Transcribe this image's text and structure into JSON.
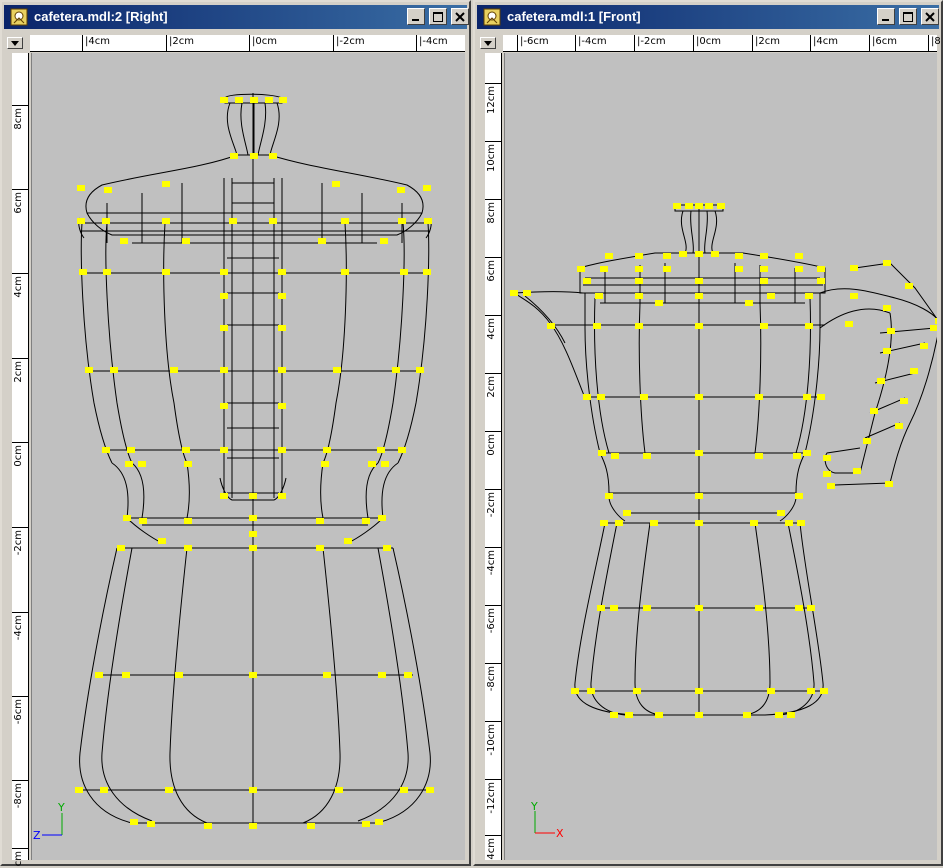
{
  "windows": [
    {
      "title": "cafetera.mdl:2 [Right]",
      "hruler": [
        "|4cm",
        "|2cm",
        "|0cm",
        "|-2cm",
        "|-4cm"
      ],
      "vruler": [
        "8cm",
        "6cm",
        "4cm",
        "2cm",
        "0cm",
        "-2cm",
        "-4cm",
        "-6cm",
        "-8cm",
        "cm"
      ],
      "axis_h": "Z",
      "axis_v": "Y"
    },
    {
      "title": "cafetera.mdl:1 [Front]",
      "hruler": [
        "|-6cm",
        "|-4cm",
        "|-2cm",
        "|0cm",
        "|2cm",
        "|4cm",
        "|6cm",
        "|8"
      ],
      "vruler": [
        "12cm",
        "10cm",
        "8cm",
        "6cm",
        "4cm",
        "2cm",
        "0cm",
        "-2cm",
        "-4cm",
        "-6cm",
        "-8cm",
        "-10cm",
        "-12cm",
        "4cm"
      ],
      "axis_h": "X",
      "axis_v": "Y"
    }
  ],
  "colors": {
    "title_start": "#0a246a",
    "title_end": "#3a6ea5",
    "viewport_bg": "#c0c0c0",
    "vertex": "#ffff00",
    "wire": "#000000",
    "axis_x": "#ff0000",
    "axis_y": "#00aa00",
    "axis_z": "#0000ff"
  },
  "icons": [
    "app-icon",
    "minimize-icon",
    "maximize-icon",
    "close-icon",
    "menu-down-arrow-icon"
  ]
}
